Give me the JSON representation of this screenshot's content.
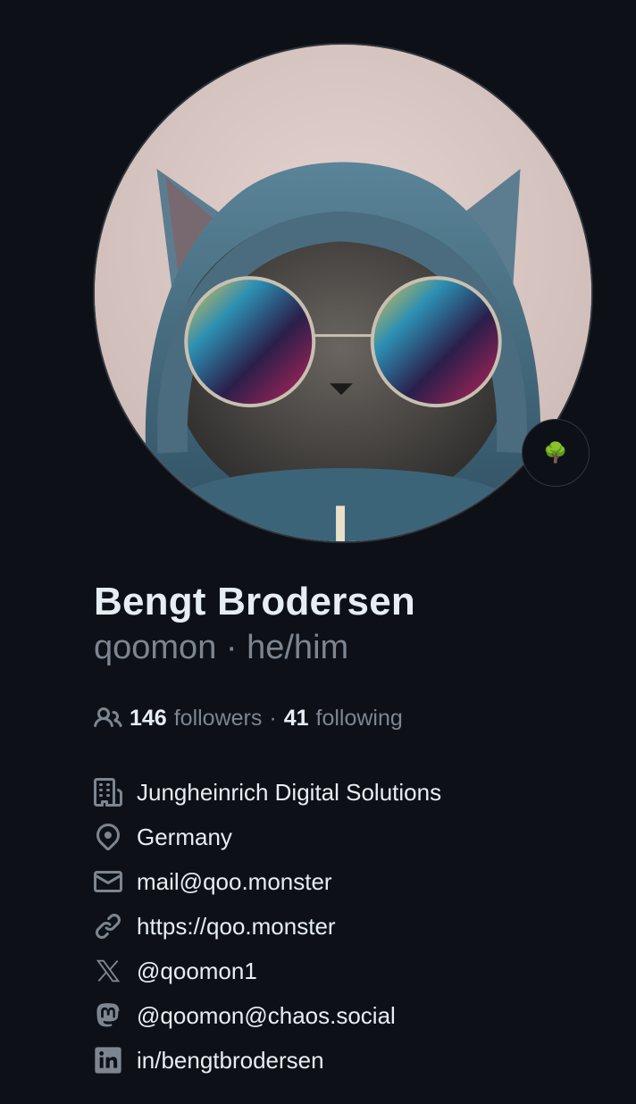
{
  "profile": {
    "full_name": "Bengt Brodersen",
    "username": "qoomon",
    "separator": "·",
    "pronouns": "he/him",
    "status_emoji": "🌳"
  },
  "follow": {
    "followers_count": "146",
    "followers_label": "followers",
    "separator": "·",
    "following_count": "41",
    "following_label": "following"
  },
  "details": {
    "company": "Jungheinrich Digital Solutions",
    "location": "Germany",
    "email": "mail@qoo.monster",
    "website": "https://qoo.monster",
    "twitter": "@qoomon1",
    "mastodon": "@qoomon@chaos.social",
    "linkedin": "in/bengtbrodersen"
  },
  "colors": {
    "background": "#0d1117",
    "text_primary": "#e6edf3",
    "text_muted": "#7d8590",
    "border": "#30363d"
  }
}
